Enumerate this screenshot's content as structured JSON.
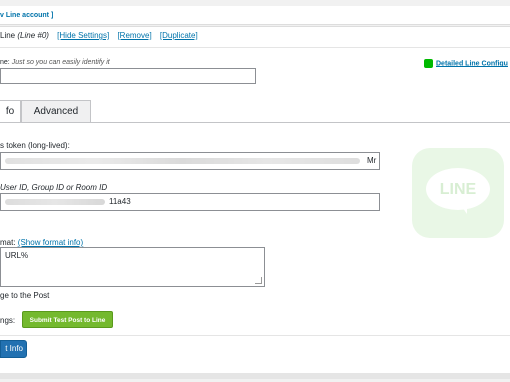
{
  "topbar": {
    "add_account_link": "v Line account ]"
  },
  "account": {
    "name": "Line",
    "id_label": "(Line #0)",
    "hide_settings": "[Hide Settings]",
    "remove": "[Remove]",
    "duplicate": "[Duplicate]"
  },
  "name_field": {
    "label": "ne:",
    "hint": "Just so you can easily identify it",
    "value": ""
  },
  "detailed_link": "Detailed Line Configu",
  "tabs": [
    {
      "label": "fo",
      "active": true
    },
    {
      "label": "Advanced",
      "active": false
    }
  ],
  "token_field": {
    "label": "s token (long-lived):",
    "visible_tail": "Mr"
  },
  "id_field": {
    "label": "User ID, Group ID or Room ID",
    "visible_tail": "11a43"
  },
  "format_field": {
    "label": "mat:",
    "show_format_link": "(Show format info)",
    "value": "URL%"
  },
  "image_option": "ge to the Post",
  "test_row": {
    "label": "ngs:",
    "button": "Submit Test Post to Line"
  },
  "bottom_button": "t Info",
  "colors": {
    "accent": "#0073aa",
    "line_green": "#00b900",
    "test_button": "#74b92e",
    "primary_button": "#2271b1"
  },
  "icons": [
    "line-chat-icon",
    "line-logo-icon"
  ]
}
